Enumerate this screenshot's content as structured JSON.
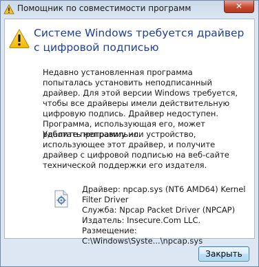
{
  "window": {
    "title": "Помощник по совместимости программ",
    "close_glyph": "✕"
  },
  "dialog": {
    "headline": "Системе Windows требуется драйвер с цифровой подписью",
    "paragraph1": "Недавно установленная программа попыталась установить неподписанный драйвер. Для этой версии Windows требуется, чтобы все драйверы имели действительную цифровую подпись. Драйвер недоступен. Программа, использующая его, может работать неправильно.",
    "paragraph2": "Удалите программу или устройство, использующее этот драйвер, и получите драйвер с цифровой подписью на веб-сайте технической поддержки его издателя.",
    "details": {
      "driver": "Драйвер: npcap.sys (NT6 AMD64) Kernel Filter Driver",
      "service": "Служба: Npcap Packet Driver (NPCAP)",
      "publisher": "Издатель: Insecure.Com LLC.",
      "location": "Размещение: C:\\Windows\\Syste...\\npcap.sys"
    }
  },
  "footer": {
    "close_button": "Закрыть"
  },
  "icons": {
    "title": "compatibility-assistant-icon",
    "warning": "warning-icon",
    "file": "system-file-icon"
  }
}
